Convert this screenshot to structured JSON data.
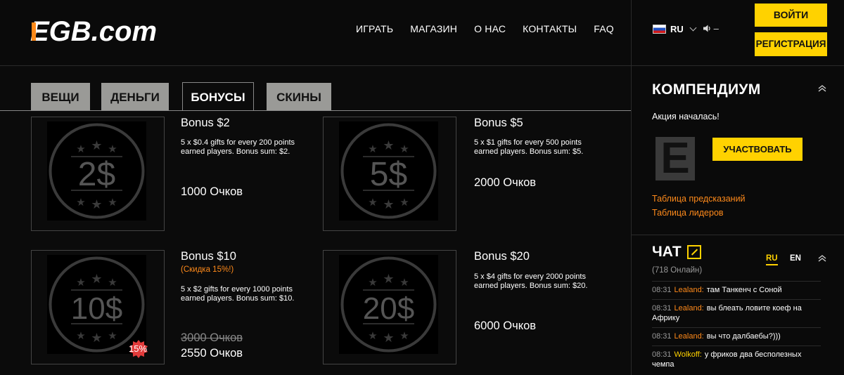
{
  "header": {
    "logo_text": "EGB.com",
    "nav": [
      "ИГРАТЬ",
      "МАГАЗИН",
      "О НАС",
      "КОНТАКТЫ",
      "FAQ"
    ],
    "lang": "RU",
    "sound_dash": "–",
    "login": "ВОЙТИ",
    "register": "РЕГИСТРАЦИЯ"
  },
  "tabs": [
    "ВЕЩИ",
    "ДЕНЬГИ",
    "БОНУСЫ",
    "СКИНЫ"
  ],
  "active_tab": "БОНУСЫ",
  "cards": [
    {
      "coin": "2$",
      "title": "Bonus $2",
      "desc": "5 x $0.4 gifts for every 200 points earned players. Bonus sum: $2.",
      "points": "1000 Очков"
    },
    {
      "coin": "5$",
      "title": "Bonus $5",
      "desc": "5 x $1 gifts for every 500 points earned players. Bonus sum: $5.",
      "points": "2000 Очков"
    },
    {
      "coin": "10$",
      "title": "Bonus $10",
      "discount": "(Скидка 15%!)",
      "desc": "5 x $2 gifts for every 1000 points earned players. Bonus sum: $10.",
      "old_points": "3000 Очков",
      "points": "2550 Очков",
      "badge": "15%"
    },
    {
      "coin": "20$",
      "title": "Bonus $20",
      "desc": "5 x $4 gifts for every 2000 points earned players. Bonus sum: $20.",
      "points": "6000 Очков"
    }
  ],
  "compendium": {
    "title": "КОМПЕНДИУМ",
    "status": "Акция началась!",
    "logo_letter": "E",
    "join": "УЧАСТВОВАТЬ",
    "link_predictions": "Таблица предсказаний",
    "link_leaders": "Таблица лидеров"
  },
  "chat": {
    "title": "ЧАТ",
    "online": "(718 Онлайн)",
    "lang_ru": "RU",
    "lang_en": "EN",
    "messages": [
      {
        "time": "08:31",
        "user": "Lealand:",
        "user_color": "#ff8a1a",
        "text": "там Танкенч с Соной"
      },
      {
        "time": "08:31",
        "user": "Lealand:",
        "user_color": "#ff8a1a",
        "text": "вы блеать ловите коеф на Африку"
      },
      {
        "time": "08:31",
        "user": "Lealand:",
        "user_color": "#ff8a1a",
        "text": "вы что далбаебы?)))"
      },
      {
        "time": "08:31",
        "user": "Wolkoff:",
        "user_color": "#ffd200",
        "text": "у фриков два бесполезных чемпа"
      }
    ]
  },
  "colors": {
    "accent": "#ffd200",
    "link": "#ff8a1a",
    "badge": "#e23b3b"
  }
}
